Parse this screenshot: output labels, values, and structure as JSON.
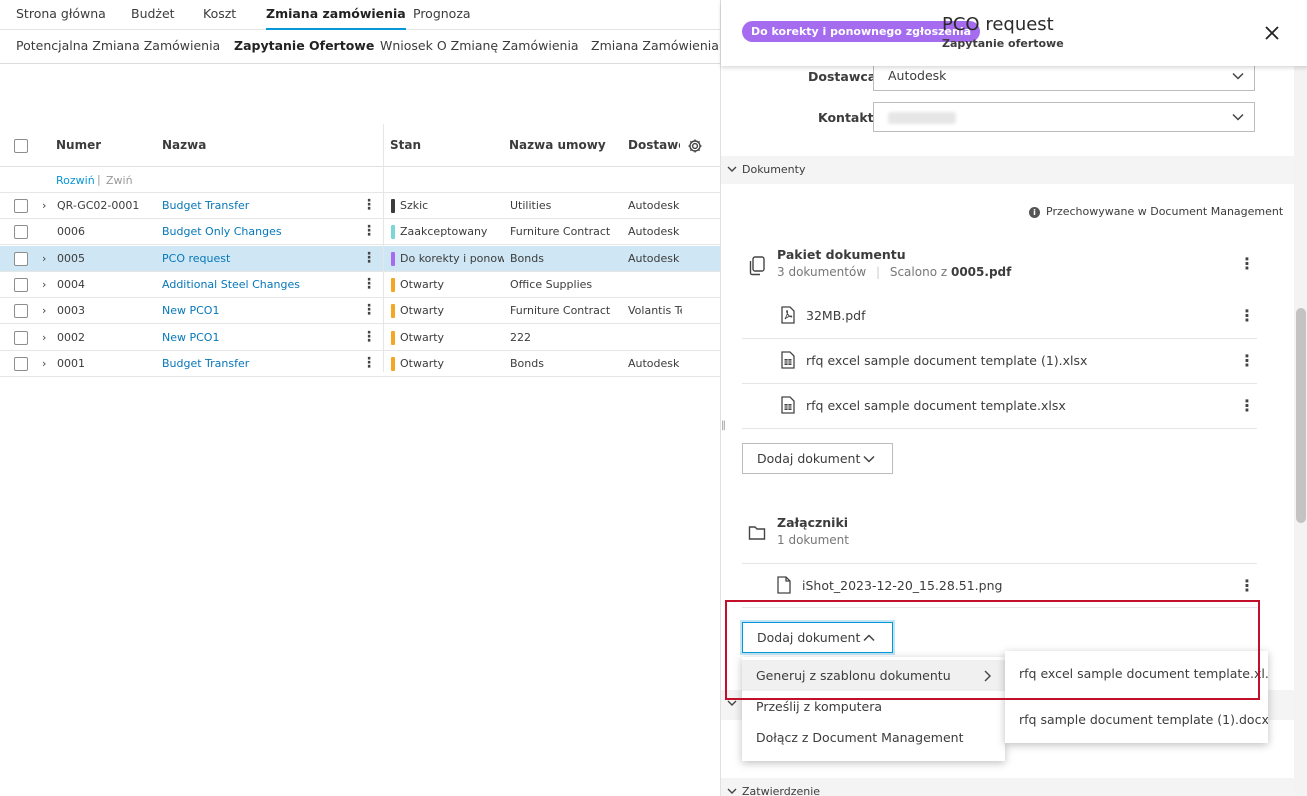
{
  "top_tabs": [
    "Strona główna",
    "Budżet",
    "Koszt",
    "Zmiana zamówienia",
    "Prognoza"
  ],
  "top_tab_active": "Zmiana zamówienia",
  "sub_tabs": [
    "Potencjalna Zmiana Zamówienia",
    "Zapytanie Ofertowe",
    "Wniosek O Zmianę Zamówienia",
    "Zmiana Zamówienia Pr"
  ],
  "sub_tab_active": "Zapytanie Ofertowe",
  "table": {
    "headers": {
      "numer": "Numer",
      "nazwa": "Nazwa",
      "stan": "Stan",
      "umowa": "Nazwa umowy",
      "dostawca": "Dostawca"
    },
    "expand_label": "Rozwiń",
    "separator": "|",
    "collapse_label": "Zwiń",
    "rows": [
      {
        "numer": "QR-GC02-0001",
        "nazwa": "Budget Transfer",
        "stan": "Szkic",
        "stan_color": "#3c3c3c",
        "umowa": "Utilities",
        "dostawca": "Autodesk",
        "expandable": true
      },
      {
        "numer": "0006",
        "nazwa": "Budget Only Changes",
        "stan": "Zaakceptowany",
        "stan_color": "#7fd6d6",
        "umowa": "Furniture Contract",
        "dostawca": "Autodesk",
        "expandable": false
      },
      {
        "numer": "0005",
        "nazwa": "PCO request",
        "stan": "Do korekty i ponow...",
        "stan_color": "#a56cf0",
        "umowa": "Bonds",
        "dostawca": "Autodesk",
        "expandable": true,
        "selected": true
      },
      {
        "numer": "0004",
        "nazwa": "Additional Steel Changes",
        "stan": "Otwarty",
        "stan_color": "#f5a623",
        "umowa": "Office Supplies",
        "dostawca": "",
        "expandable": true
      },
      {
        "numer": "0003",
        "nazwa": "New PCO1",
        "stan": "Otwarty",
        "stan_color": "#f5a623",
        "umowa": "Furniture Contract",
        "dostawca": "Volantis Te",
        "expandable": true
      },
      {
        "numer": "0002",
        "nazwa": "New PCO1",
        "stan": "Otwarty",
        "stan_color": "#f5a623",
        "umowa": "222",
        "dostawca": "",
        "expandable": true
      },
      {
        "numer": "0001",
        "nazwa": "Budget Transfer",
        "stan": "Otwarty",
        "stan_color": "#f5a623",
        "umowa": "Bonds",
        "dostawca": "Autodesk",
        "expandable": true
      }
    ]
  },
  "panel": {
    "badge": "Do korekty i ponownego zgłoszenia",
    "badge_color": "#a56cf0",
    "title": "PCO request",
    "subtitle": "Zapytanie ofertowe",
    "vendor_label": "Dostawca",
    "vendor_value": "Autodesk",
    "contact_label": "Kontakt",
    "documents_section": "Dokumenty",
    "storage_note": "Przechowywane w Document Management",
    "package": {
      "title": "Pakiet dokumentu",
      "count": "3 dokumentów",
      "merged_prefix": "Scalono z",
      "merged_file": "0005.pdf",
      "files": [
        "32MB.pdf",
        "rfq excel sample document template (1).xlsx",
        "rfq excel sample document template.xlsx"
      ]
    },
    "add_doc_label": "Dodaj dokument",
    "attachments": {
      "title": "Załączniki",
      "count": "1 dokument",
      "files": [
        "iShot_2023-12-20_15.28.51.png"
      ]
    },
    "add_menu": [
      "Generuj z szablonu dokumentu",
      "Prześlij z komputera",
      "Dołącz z Document Management"
    ],
    "template_menu": [
      "rfq excel sample document template.xl...",
      "rfq sample document template (1).docx"
    ],
    "approval_section": "Zatwierdzenie"
  },
  "colors": {
    "accent": "#0696d7",
    "highlight": "#c2102b",
    "selected_row": "#cfe7f5"
  }
}
